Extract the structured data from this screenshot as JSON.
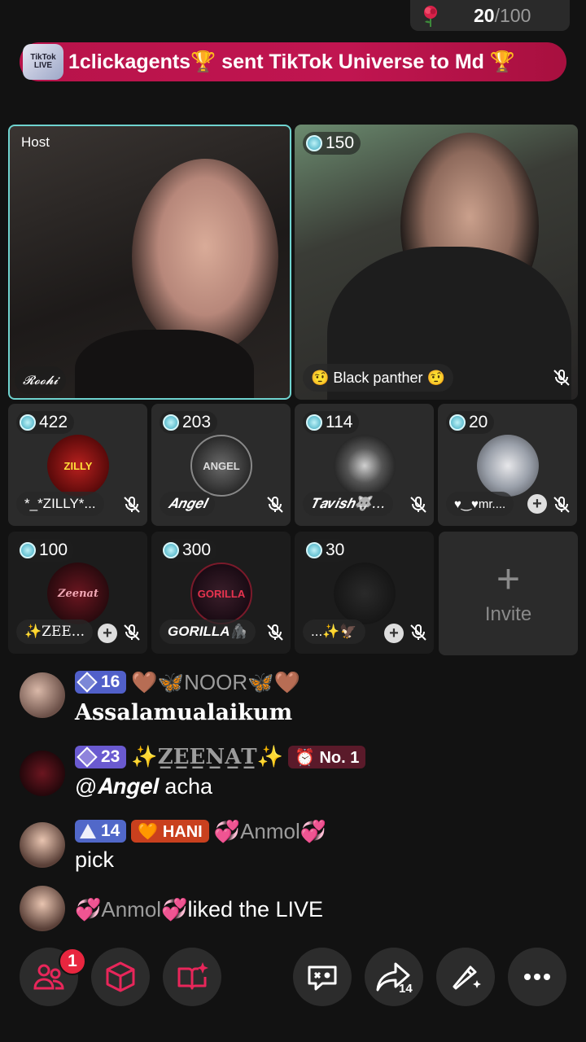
{
  "goal": {
    "count": "20",
    "total": "/100",
    "icon": "rose-icon"
  },
  "banner": {
    "badge_text": "TikTok LIVE",
    "text": "1clickagents🏆 sent TikTok Universe to Md 🏆"
  },
  "host": {
    "label": "Host",
    "name": "𝓡𝓸𝓸𝓱𝓲"
  },
  "guest_main": {
    "score": "150",
    "name": "🤨 Black panther 🤨"
  },
  "guests": [
    {
      "score": "422",
      "name": "*_*ZILLY*...",
      "avatar_text": "ZILLY"
    },
    {
      "score": "203",
      "name": "𝑨𝒏𝒈𝒆𝒍",
      "avatar_text": "ANGEL"
    },
    {
      "score": "114",
      "name": "𝑻𝒂𝒗𝒊𝒔𝒉🐺...",
      "avatar_text": ""
    },
    {
      "score": "20",
      "name": "♥‿♥mr....",
      "avatar_text": ""
    },
    {
      "score": "100",
      "name": "✨ZEE...",
      "avatar_text": "Zeenat"
    },
    {
      "score": "300",
      "name": "GORILLA🦍",
      "avatar_text": "GORILLA"
    },
    {
      "score": "30",
      "name": "...✨🦅",
      "avatar_text": ""
    }
  ],
  "invite": {
    "plus": "+",
    "label": "Invite"
  },
  "chat": [
    {
      "level": "16",
      "user": "🤎🦋NOOR🦋🤎",
      "text": "Assalamualaikum",
      "badges": []
    },
    {
      "level": "23",
      "user": "✨Z̲E̲E̲N̲A̲T̲✨",
      "text": "@𝑨𝒏𝒈𝒆𝒍 acha",
      "badges": [
        "⏰ No. 1"
      ]
    },
    {
      "level": "14",
      "user": "💞Anmol💞",
      "text": "pick",
      "badges": [
        "🧡 HANI"
      ]
    },
    {
      "level": "",
      "user": "💞Anmol💞",
      "text": " liked the LIVE",
      "badges": []
    }
  ],
  "bottom_bar": {
    "notification_count": "1",
    "share_count": "14",
    "buttons": [
      "people-icon",
      "cube-icon",
      "book-sparkle-icon",
      "gamepad-icon",
      "share-icon",
      "magic-wand-icon",
      "more-icon"
    ]
  },
  "colors": {
    "accent_pink": "#e8265a",
    "banner": "#c01550",
    "host_border": "#6fd3cf"
  }
}
